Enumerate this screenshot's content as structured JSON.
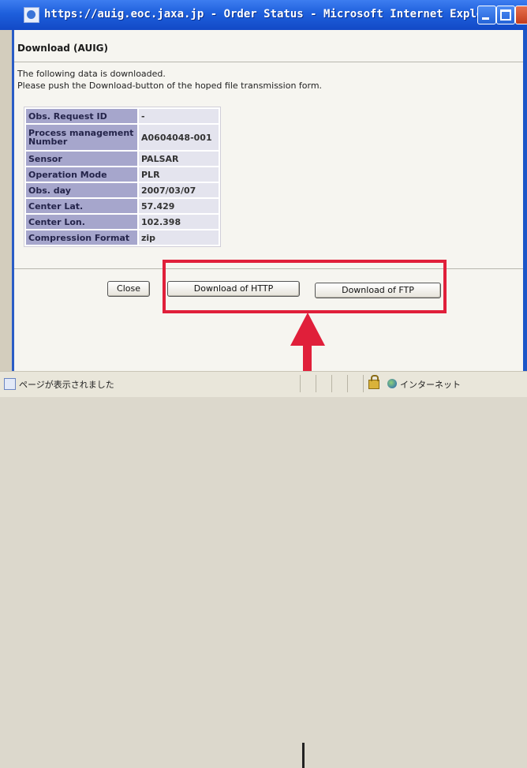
{
  "window": {
    "title": "https://auig.eoc.jaxa.jp - Order Status - Microsoft Internet Explorer"
  },
  "page": {
    "title": "Download (AUIG)",
    "message_line1": "The following data is downloaded.",
    "message_line2": "Please push the Download-button of the hoped file transmission form."
  },
  "info_table": {
    "rows": [
      {
        "label": "Obs. Request ID",
        "value": "-"
      },
      {
        "label": "Process management Number",
        "value": "A0604048-001"
      },
      {
        "label": "Sensor",
        "value": "PALSAR"
      },
      {
        "label": "Operation Mode",
        "value": "PLR"
      },
      {
        "label": "Obs. day",
        "value": "2007/03/07"
      },
      {
        "label": "Center Lat.",
        "value": "57.429"
      },
      {
        "label": "Center Lon.",
        "value": "102.398"
      },
      {
        "label": "Compression Format",
        "value": "zip"
      }
    ]
  },
  "buttons": {
    "close": "Close",
    "http": "Download of HTTP",
    "ftp": "Download of FTP"
  },
  "statusbar": {
    "text": "ページが表示されました",
    "zone": "インターネット"
  },
  "colors": {
    "titlebar": "#1e5fdc",
    "highlight": "#e01f3a",
    "table_key_bg": "#a6a6cc",
    "table_value_bg": "#e4e4ee"
  }
}
